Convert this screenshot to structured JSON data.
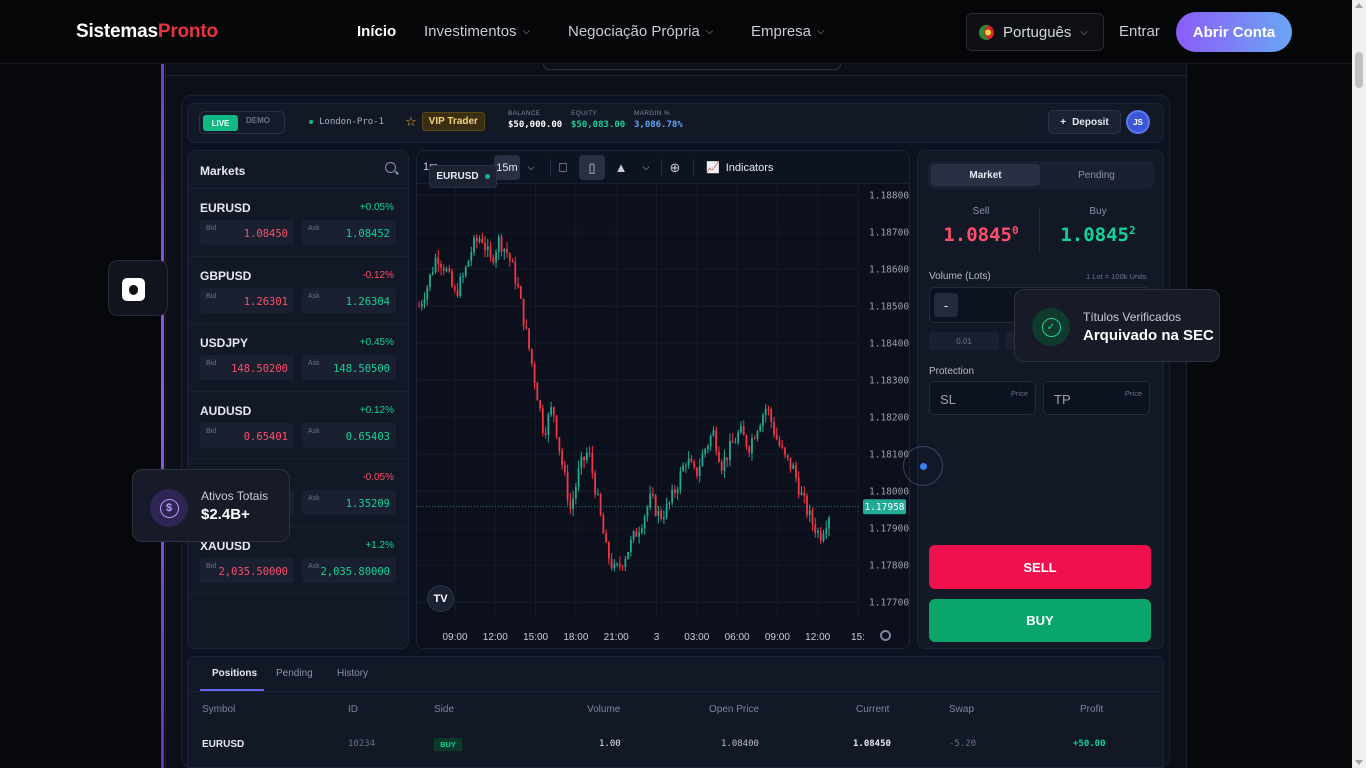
{
  "nav": {
    "logo_part1": "Sistemas",
    "logo_part2": "Pronto",
    "links": [
      "Início",
      "Investimentos",
      "Negociação Própria",
      "Empresa"
    ],
    "language": "Português",
    "login": "Entrar",
    "cta": "Abrir Conta"
  },
  "account": {
    "live": "LIVE",
    "demo": "DEMO",
    "server": "London-Pro-1",
    "tier": "VIP Trader",
    "balance_label": "BALANCE",
    "balance": "$50,000.00",
    "equity_label": "EQUITY",
    "equity": "$50,083.00",
    "margin_label": "MARGIN %",
    "margin": "3,086.78%",
    "deposit": "Deposit",
    "avatar": "JS",
    "colors": {
      "equity": "#10d39a",
      "margin": "#60a5fa"
    }
  },
  "markets": {
    "title": "Markets",
    "bid_label": "Bid",
    "ask_label": "Ask",
    "rows": [
      {
        "symbol": "EURUSD",
        "change": "+0.05%",
        "dir": "up",
        "bid": "1.08450",
        "ask": "1.08452"
      },
      {
        "symbol": "GBPUSD",
        "change": "-0.12%",
        "dir": "down",
        "bid": "1.26301",
        "ask": "1.26304"
      },
      {
        "symbol": "USDJPY",
        "change": "+0.45%",
        "dir": "up",
        "bid": "148.50200",
        "ask": "148.50500"
      },
      {
        "symbol": "AUDUSD",
        "change": "+0.12%",
        "dir": "up",
        "bid": "0.65401",
        "ask": "0.65403"
      },
      {
        "symbol": "",
        "change": "-0.05%",
        "dir": "down",
        "bid": "",
        "ask": "1.35209"
      },
      {
        "symbol": "XAUUSD",
        "change": "+1.2%",
        "dir": "up",
        "bid": "2,035.50000",
        "ask": "2,035.80000"
      }
    ]
  },
  "chart": {
    "symbol": "EURUSD",
    "timeframes": [
      "1m",
      "15m"
    ],
    "active_timeframe": "15m",
    "indicators": "Indicators",
    "last_price": "1.17958",
    "colors": {
      "up": "#22ab94",
      "down": "#f23645",
      "last": "#22ab94"
    }
  },
  "chart_data": {
    "type": "candlestick",
    "series_name": "EURUSD",
    "x_ticks": [
      "09:00",
      "12:00",
      "15:00",
      "18:00",
      "21:00",
      "3",
      "03:00",
      "06:00",
      "09:00",
      "12:00",
      "15:"
    ],
    "y_ticks": [
      "1.18800",
      "1.18700",
      "1.18600",
      "1.18500",
      "1.18400",
      "1.18300",
      "1.18200",
      "1.18100",
      "1.18000",
      "1.17900",
      "1.17800",
      "1.17700"
    ],
    "ylim": [
      1.1766,
      1.1883
    ],
    "last": 1.17958,
    "close_path": [
      1.185,
      1.1856,
      1.1864,
      1.186,
      1.1853,
      1.1858,
      1.1866,
      1.1869,
      1.1862,
      1.1868,
      1.1864,
      1.1856,
      1.1843,
      1.183,
      1.1816,
      1.1823,
      1.1808,
      1.1795,
      1.1806,
      1.1811,
      1.1798,
      1.1784,
      1.1778,
      1.1782,
      1.1787,
      1.1792,
      1.1798,
      1.1793,
      1.1796,
      1.1802,
      1.1809,
      1.1804,
      1.1811,
      1.1816,
      1.1807,
      1.1812,
      1.1816,
      1.1812,
      1.1818,
      1.1823,
      1.1815,
      1.1809,
      1.1806,
      1.1798,
      1.1792,
      1.1788,
      1.1794
    ]
  },
  "order": {
    "tab_market": "Market",
    "tab_pending": "Pending",
    "sell_label": "Sell",
    "sell_price": "1.0845",
    "sell_pip": "0",
    "buy_label": "Buy",
    "buy_price": "1.0845",
    "buy_pip": "2",
    "volume_label": "Volume (Lots)",
    "volume_unit": "1 Lot = 100k Units",
    "minus": "-",
    "chip1": "0.01",
    "protection_label": "Protection",
    "sl": "SL",
    "tp": "TP",
    "price_hint": "Price",
    "sell_btn": "SELL",
    "buy_btn": "BUY"
  },
  "positions": {
    "tabs": [
      "Positions",
      "Pending",
      "History"
    ],
    "columns": [
      "Symbol",
      "ID",
      "Side",
      "Volume",
      "Open Price",
      "Current",
      "Swap",
      "Profit"
    ],
    "rows": [
      {
        "symbol": "EURUSD",
        "id": "10234",
        "side": "BUY",
        "volume": "1.00",
        "open": "1.08400",
        "current": "1.08450",
        "swap": "-5.20",
        "profit": "+50.00"
      }
    ]
  },
  "badges": {
    "assets_label": "Ativos Totais",
    "assets_value": "$2.4B+",
    "sec_label": "Títulos Verificados",
    "sec_value": "Arquivado na SEC"
  }
}
